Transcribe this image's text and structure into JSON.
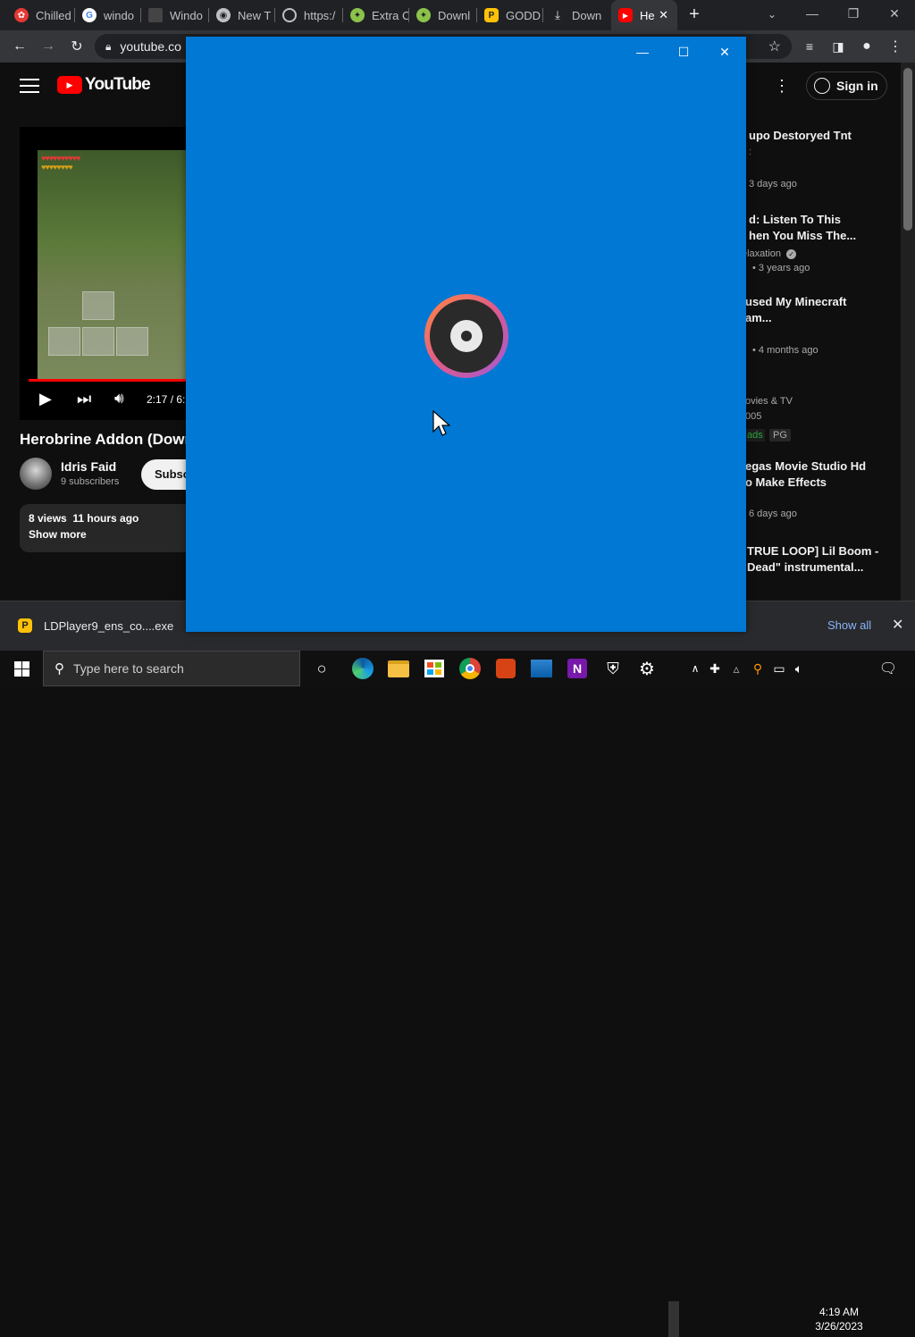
{
  "browser": {
    "tabs": [
      {
        "label": "Chilled",
        "icon": "scratch-icon"
      },
      {
        "label": "windo",
        "icon": "google-icon"
      },
      {
        "label": "Windo",
        "icon": "page-icon"
      },
      {
        "label": "New T",
        "icon": "chrome-icon"
      },
      {
        "label": "https:/",
        "icon": "globe-icon"
      },
      {
        "label": "Extra C",
        "icon": "android-icon"
      },
      {
        "label": "Downl",
        "icon": "android-icon"
      },
      {
        "label": "GODD",
        "icon": "ldplayer-icon"
      },
      {
        "label": "Down",
        "icon": "download-icon"
      },
      {
        "label": "He",
        "icon": "youtube-icon"
      }
    ],
    "url": "youtube.co"
  },
  "youtube": {
    "logo": "YouTube",
    "sign_in": "Sign in",
    "player": {
      "time": "2:17 / 6:"
    },
    "video_title": "Herobrine Addon (Downl",
    "channel": {
      "name": "Idris Faid",
      "subscribers": "9 subscribers",
      "subscribe": "Subsc"
    },
    "description": {
      "stats": "8 views  11 hours ago",
      "show_more": "Show more"
    },
    "recommendations": [
      {
        "title_lines": [
          "upo Destoryed Tnt"
        ],
        "meta_lines": [
          "3 days ago"
        ]
      },
      {
        "title_lines": [
          "d: Listen To This",
          "hen You Miss The..."
        ],
        "meta_lines": [
          "elaxation",
          "• 3 years ago"
        ]
      },
      {
        "title_lines": [
          "used My Minecraft",
          "am..."
        ],
        "meta_lines": [
          "• 4 months ago"
        ]
      },
      {
        "title_lines": [],
        "meta_lines": [
          "ovies & TV",
          "005"
        ],
        "badges": [
          "ads",
          "PG"
        ]
      },
      {
        "title_lines": [
          "egas Movie Studio Hd",
          "o Make Effects"
        ],
        "meta_lines": [
          "6 days ago"
        ]
      },
      {
        "title_lines": [
          "TRUE LOOP] Lil Boom -",
          "Dead\" instrumental..."
        ],
        "meta_lines": []
      }
    ]
  },
  "downloads": {
    "file": "LDPlayer9_ens_co....exe",
    "show_all": "Show all"
  },
  "taskbar": {
    "search_placeholder": "Type here to search",
    "time": "4:19 AM",
    "date": "3/26/2023"
  },
  "colors": {
    "splash_bg": "#0078d4",
    "yt_red": "#ff0000",
    "accent": "#3ea6ff"
  }
}
